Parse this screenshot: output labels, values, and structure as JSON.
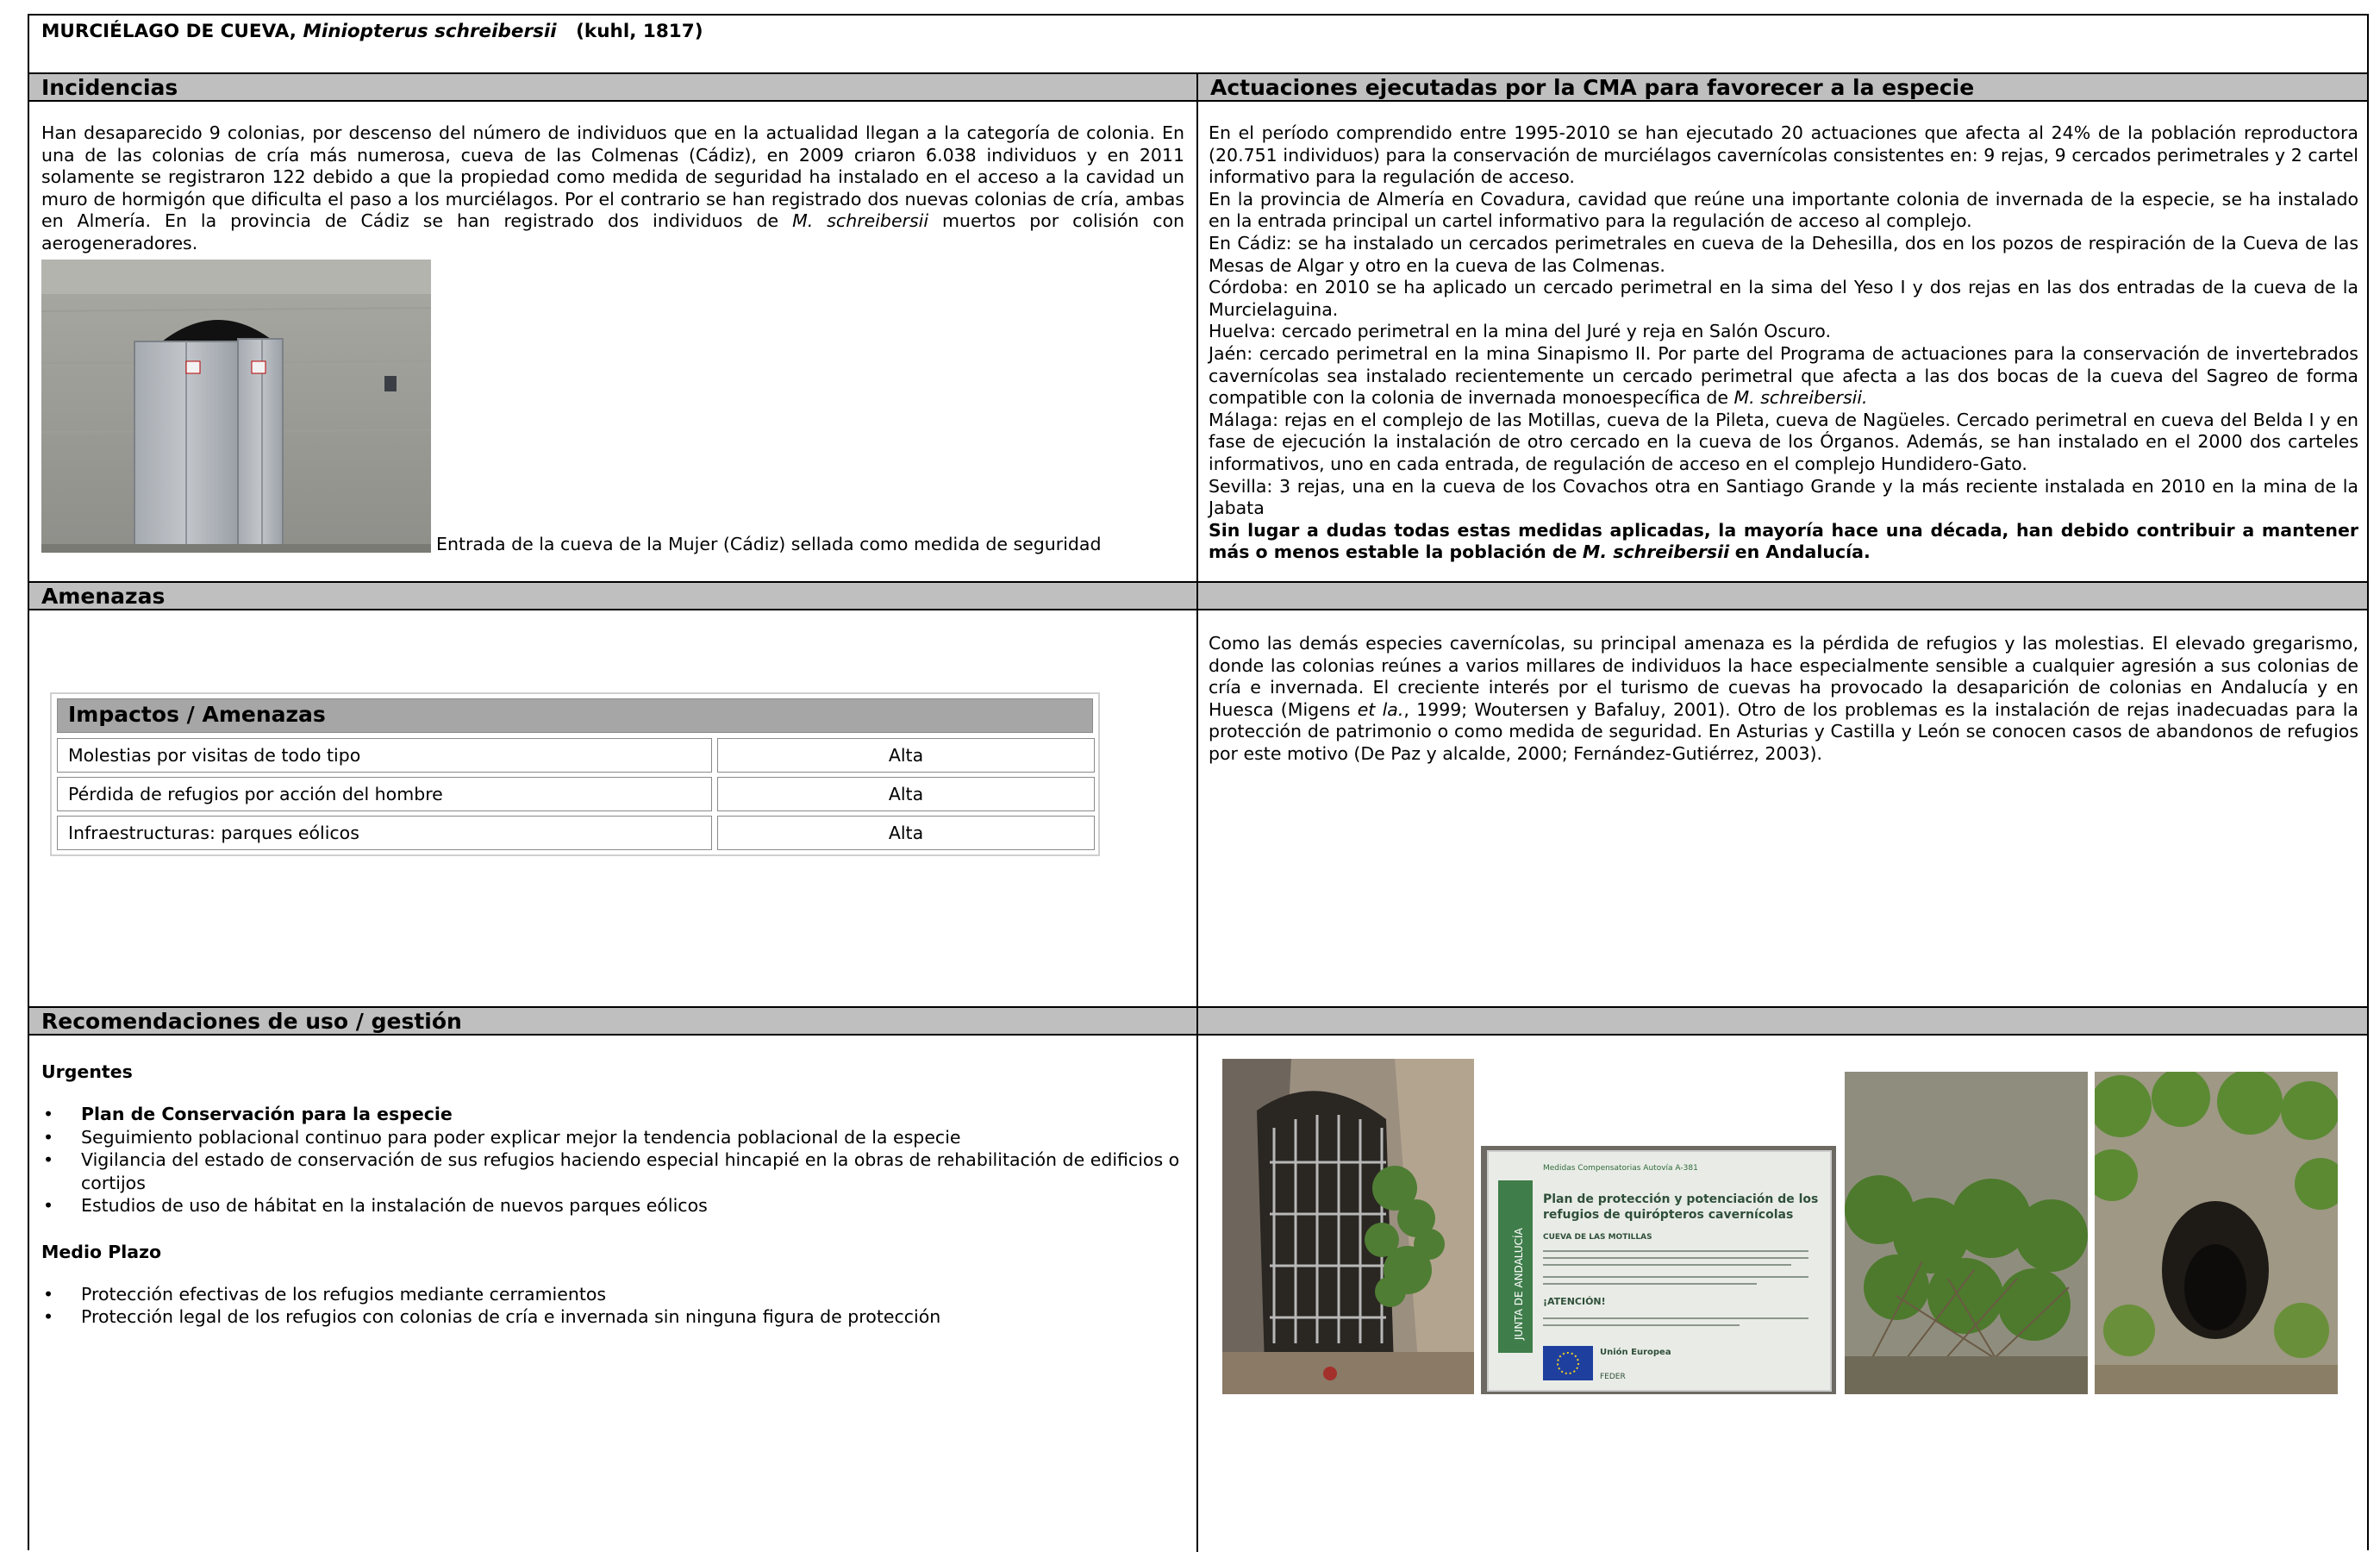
{
  "title": {
    "common_name": "MURCIÉLAGO DE CUEVA,",
    "scientific_name": "Miniopterus schreibersii",
    "authority": "(kuhl, 1817)"
  },
  "incidencias": {
    "header": "Incidencias",
    "text_1": "Han desaparecido 9 colonias, por descenso del número de individuos que en la actualidad llegan a la categoría de colonia. En una de las colonias de cría más numerosa, cueva de las Colmenas (Cádiz), en 2009 criaron 6.038 individuos y en 2011 solamente se registraron 122 debido a que la propiedad como medida de seguridad ha instalado en el acceso a la cavidad un muro de hormigón que dificulta el paso a los murciélagos. Por el contrario se han registrado dos nuevas colonias de cría, ambas en Almería. En la provincia de Cádiz se han registrado dos individuos de",
    "text_species": "M. schreibersii",
    "text_2": "muertos por colisión con aerogeneradores.",
    "photo_caption": "Entrada de la cueva de la Mujer (Cádiz) sellada como medida de seguridad"
  },
  "actuaciones": {
    "header": "Actuaciones ejecutadas por la CMA para favorecer a la especie",
    "p1": "En el período comprendido entre 1995-2010 se han ejecutado 20 actuaciones que afecta al 24% de la población reproductora (20.751 individuos) para la conservación de murciélagos cavernícolas consistentes en: 9 rejas, 9 cercados perimetrales y 2 cartel informativo para la regulación de acceso.",
    "p2": "En la provincia de Almería en Covadura, cavidad que  reúne una importante colonia de invernada de la especie, se ha instalado en la entrada principal un cartel informativo para la regulación de acceso al complejo.",
    "p3": "En Cádiz: se ha instalado un cercados perimetrales en cueva de la Dehesilla, dos en los pozos de respiración de la Cueva de las Mesas de Algar y otro en la cueva de las Colmenas.",
    "p4": "Córdoba: en 2010 se ha aplicado un cercado perimetral en la sima del Yeso I y dos rejas  en las dos entradas de la cueva de la Murcielaguina.",
    "p5": "Huelva: cercado perimetral en la mina del Juré y reja en Salón Oscuro.",
    "p6": "Jaén:  cercado perimetral en la mina Sinapismo II.  Por parte del Programa de actuaciones para la conservación de invertebrados cavernícolas sea instalado recientemente un cercado perimetral que afecta a las dos bocas de la cueva del Sagreo de forma compatible con la colonia de invernada monoespecífica de",
    "p6_species": "M. schreibersii.",
    "p7": "Málaga: rejas en el complejo de las Motillas, cueva de la Pileta, cueva de Nagüeles. Cercado perimetral en cueva del Belda I y en fase de ejecución la instalación de otro cercado en la cueva de los Órganos. Además, se han instalado  en el 2000 dos carteles informativos, uno en cada entrada, de regulación de acceso en el complejo Hundidero-Gato.",
    "p8": "Sevilla: 3 rejas, una en la cueva de los Covachos otra en  Santiago Grande y la más reciente instalada en 2010 en la mina de la Jabata",
    "p9_bold": "Sin lugar a dudas todas estas medidas aplicadas, la mayoría hace una década, han debido contribuir a mantener más o menos estable la población de",
    "p9_species": "M. schreibersii",
    "p9_end": "en Andalucía."
  },
  "amenazas": {
    "header": "Amenazas",
    "table_title": "Impactos / Amenazas",
    "rows": [
      {
        "impacto": "Molestias por visitas de todo tipo",
        "nivel": "Alta"
      },
      {
        "impacto": "Pérdida de refugios por acción del hombre",
        "nivel": "Alta"
      },
      {
        "impacto": "Infraestructuras: parques eólicos",
        "nivel": "Alta"
      }
    ],
    "text_1": "Como las demás especies cavernícolas, su principal amenaza es la pérdida de refugios y las molestias. El elevado gregarismo, donde las colonias reúnes a varios millares de individuos la hace especialmente sensible a cualquier agresión a sus colonias de cría e invernada. El creciente interés por el turismo de cuevas ha provocado la desaparición de colonias en Andalucía y en Huesca (Migens",
    "text_etal": "et la.",
    "text_2": ", 1999; Woutersen y Bafaluy, 2001). Otro de los problemas es la instalación de rejas inadecuadas para la protección de patrimonio o como medida de seguridad. En Asturias y Castilla y León se conocen casos de abandonos de refugios por este motivo (De Paz y alcalde, 2000; Fernández-Gutiérrez, 2003)."
  },
  "recomendaciones": {
    "header": "Recomendaciones de uso / gestión",
    "urgentes_label": "Urgentes",
    "urgentes": [
      "Plan de Conservación para la especie",
      "Seguimiento poblacional continuo para poder explicar mejor la tendencia poblacional de la especie",
      "Vigilancia del estado de conservación de sus refugios haciendo especial hincapié en la obras de rehabilitación de edificios o cortijos",
      "Estudios de uso de hábitat en la instalación de nuevos parques eólicos"
    ],
    "medio_label": "Medio Plazo",
    "medio": [
      "Protección efectivas de los refugios mediante cerramientos",
      "Protección legal de los refugios con colonias de cría e invernada sin ninguna figura de protección"
    ],
    "bullet": "•"
  },
  "sign": {
    "top_left": "Medidas Compensatorias  Autovía A-381",
    "title_line1": "Plan de protección y potenciación de los",
    "title_line2": "refugios de quirópteros cavernícolas",
    "subtitle": "CUEVA DE LAS MOTILLAS",
    "attention": "¡ATENCIÓN!",
    "side": "JUNTA DE ANDALUCÍA",
    "eu": "Unión Europea",
    "feder": "FEDER"
  },
  "colors": {
    "header_bg": "#bfbfbf",
    "table_header_bg": "#a6a6a6",
    "sign_green": "#3f7d4a"
  }
}
